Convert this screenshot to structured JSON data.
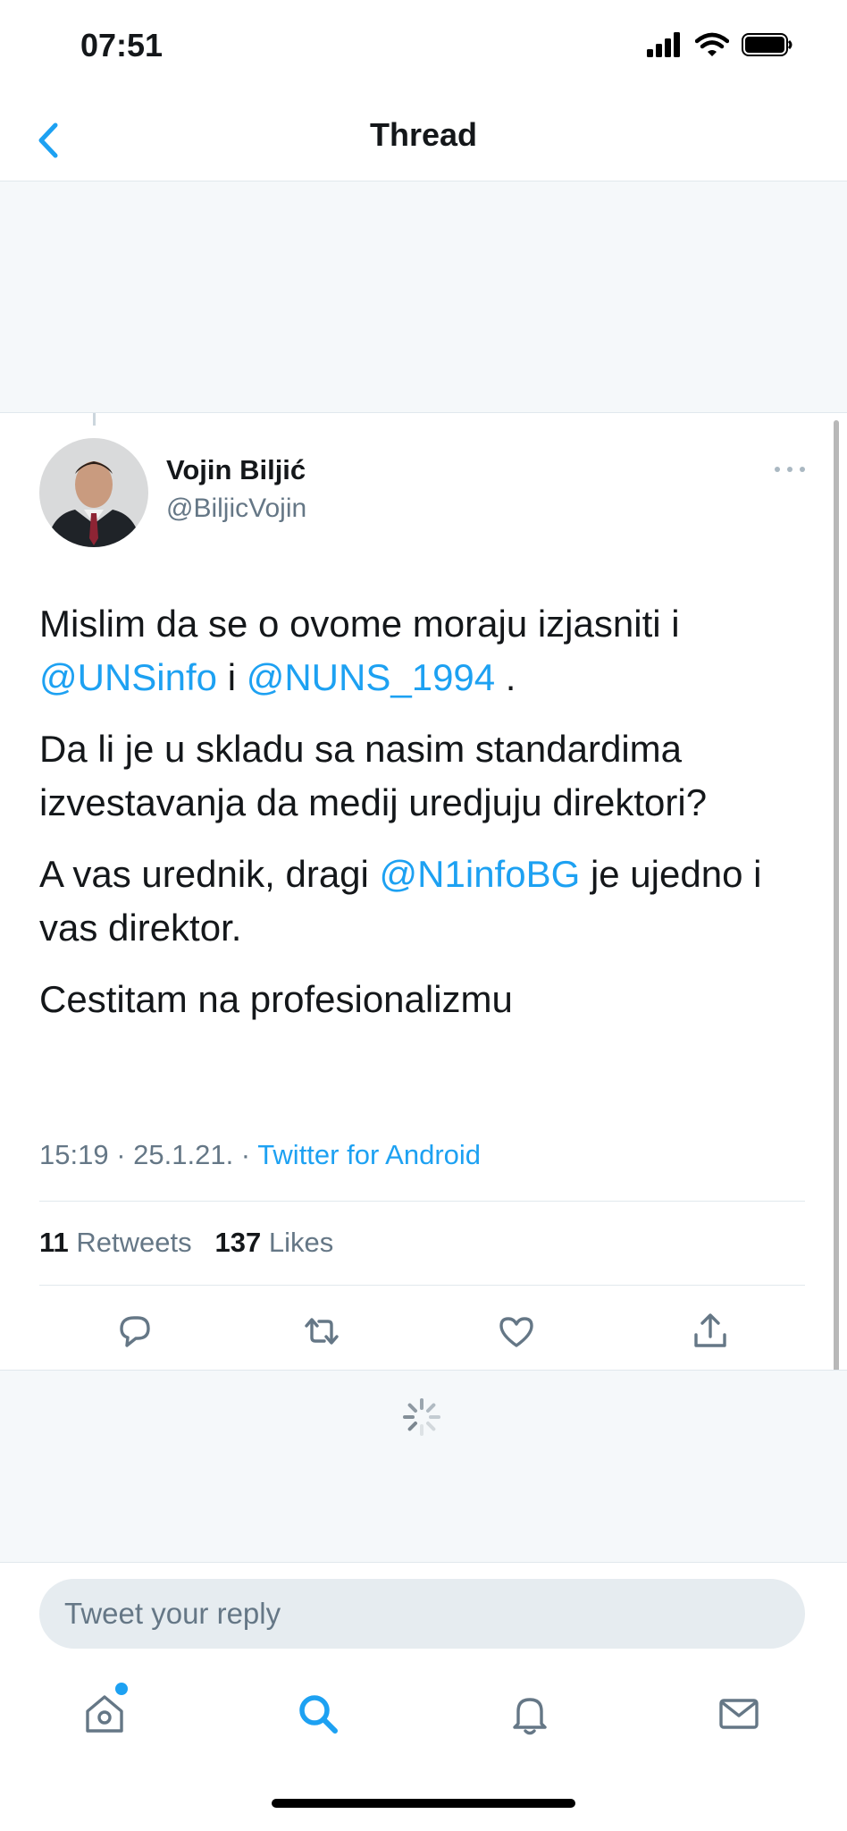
{
  "status_bar": {
    "time": "07:51"
  },
  "nav": {
    "title": "Thread",
    "back_icon": "chevron-left-icon"
  },
  "tweet": {
    "author_name": "Vojin Biljić",
    "author_handle": "@BiljicVojin",
    "paragraphs": {
      "p1_a": "Mislim da se o ovome moraju izjasniti i",
      "p1_mention1": "@UNSinfo",
      "p1_mid": " i ",
      "p1_mention2": "@NUNS_1994",
      "p1_end": " .",
      "p2": "Da li je u skladu sa nasim standardima izvestavanja da medij uredjuju direktori?",
      "p3_a": "A vas urednik, dragi ",
      "p3_mention": "@N1infoBG",
      "p3_b": " je ujedno i vas direktor.",
      "p4": "Cestitam na profesionalizmu"
    },
    "time": "15:19",
    "sep": " · ",
    "date": "25.1.21.",
    "sep2": " · ",
    "source": "Twitter for Android",
    "retweets_count": "11",
    "retweets_label": "Retweets",
    "likes_count": "137",
    "likes_label": "Likes"
  },
  "actions": [
    "reply-icon",
    "retweet-icon",
    "like-icon",
    "share-icon"
  ],
  "reply": {
    "placeholder": "Tweet your reply"
  },
  "tabs": [
    "home-icon",
    "search-icon",
    "notifications-icon",
    "messages-icon"
  ],
  "colors": {
    "accent": "#1da1f2",
    "muted": "#657786",
    "text": "#14171a",
    "background_gray": "#f5f8fa"
  }
}
